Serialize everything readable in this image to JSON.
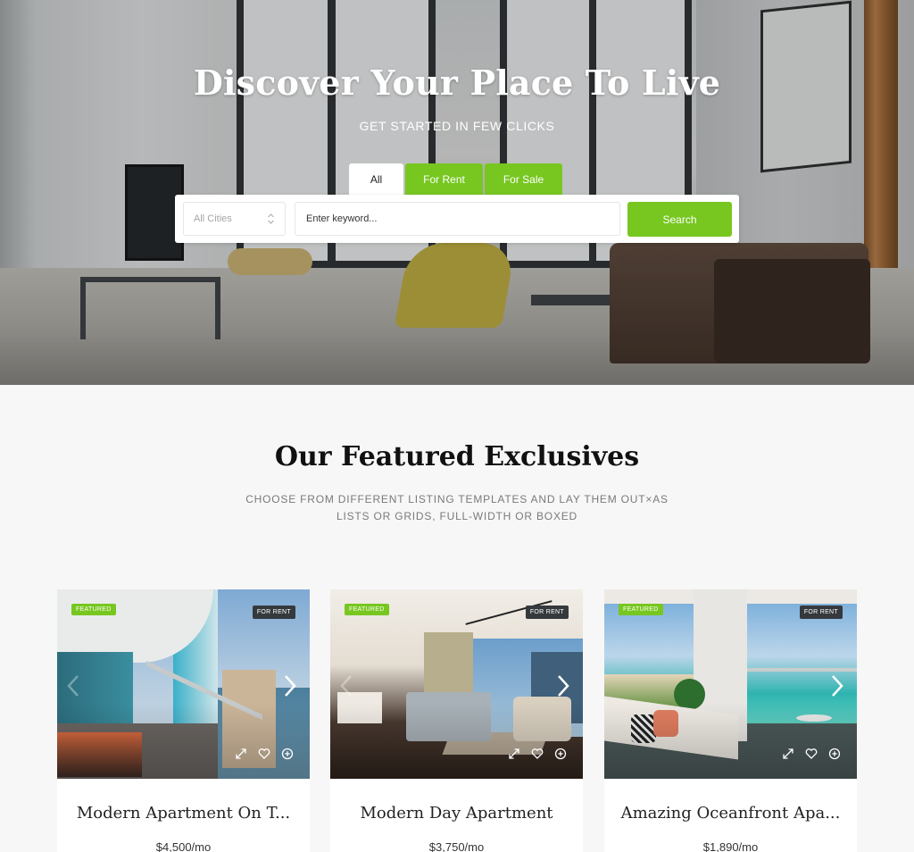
{
  "hero": {
    "title": "Discover Your Place To Live",
    "subtitle": "GET STARTED IN FEW CLICKS",
    "tabs": [
      {
        "label": "All",
        "active": true
      },
      {
        "label": "For Rent",
        "active": false
      },
      {
        "label": "For Sale",
        "active": false
      }
    ],
    "search": {
      "city_select_value": "All Cities",
      "keyword_placeholder": "Enter keyword...",
      "keyword_value": "",
      "button_label": "Search"
    }
  },
  "featured": {
    "title": "Our Featured Exclusives",
    "description": "CHOOSE FROM DIFFERENT LISTING TEMPLATES AND LAY THEM OUT×AS LISTS OR GRIDS, FULL-WIDTH OR BOXED",
    "listings": [
      {
        "title": "Modern Apartment On T...",
        "price": "$4,500/mo",
        "featured_badge": "FEATURED",
        "status_badge": "FOR RENT"
      },
      {
        "title": "Modern Day Apartment",
        "price": "$3,750/mo",
        "featured_badge": "FEATURED",
        "status_badge": "FOR RENT"
      },
      {
        "title": "Amazing Oceanfront Apa...",
        "price": "$1,890/mo",
        "featured_badge": "FEATURED",
        "status_badge": "FOR RENT"
      }
    ]
  },
  "colors": {
    "accent": "#77c720",
    "badge_dark": "#35393d",
    "page_bg": "#f7f7f7"
  },
  "icons": {
    "city_select": "updown-chevron-icon",
    "card_prev": "chevron-left-icon",
    "card_next": "chevron-right-icon",
    "card_expand": "expand-icon",
    "card_favorite": "heart-icon",
    "card_compare": "plus-circle-icon"
  }
}
